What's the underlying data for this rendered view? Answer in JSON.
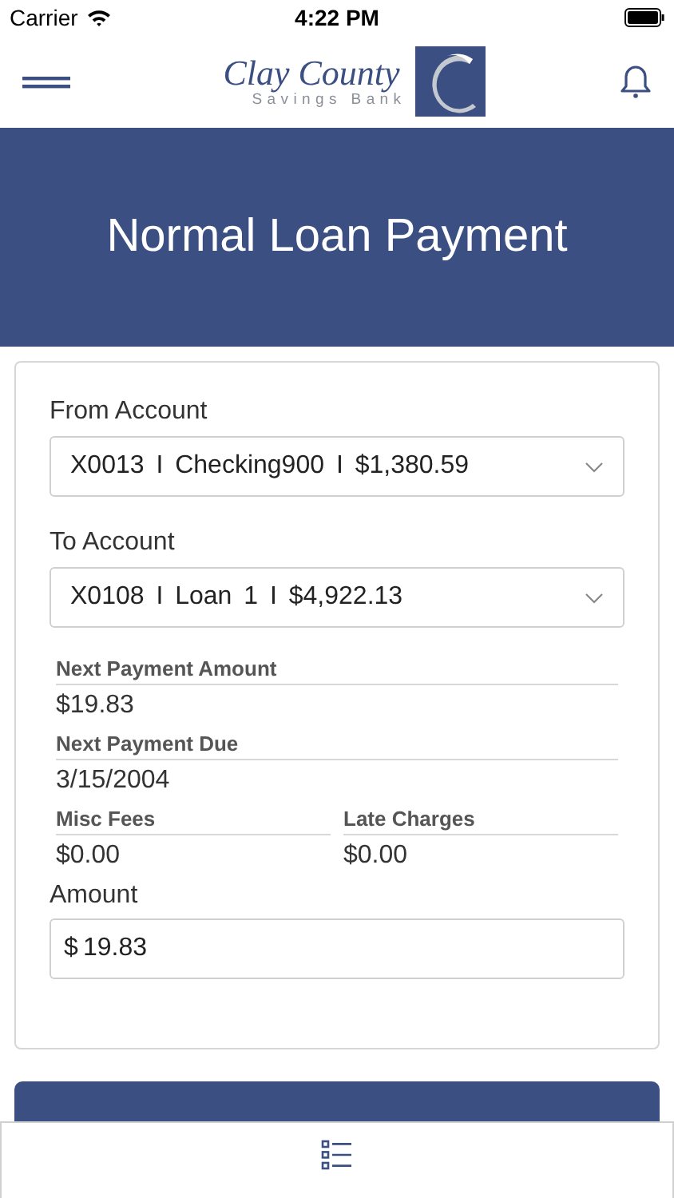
{
  "status_bar": {
    "carrier": "Carrier",
    "time": "4:22 PM"
  },
  "logo": {
    "name": "Clay County",
    "subtitle": "Savings Bank"
  },
  "title": "Normal Loan Payment",
  "accounts": [
    {
      "label": "From Account",
      "value": "X0013 I Checking900 I $1,380.59"
    },
    {
      "label": "To Account",
      "value": "X0108 I Loan 1 I $4,922.13"
    }
  ],
  "detail_rows": [
    [
      {
        "label": "Next Payment Amount",
        "value": "$19.83"
      }
    ],
    [
      {
        "label": "Next Payment Due",
        "value": "3/15/2004"
      }
    ],
    [
      {
        "label": "Misc Fees",
        "value": "$0.00"
      },
      {
        "label": "Late Charges",
        "value": "$0.00"
      }
    ]
  ],
  "amount": {
    "label": "Amount",
    "currency": "$",
    "value": "19.83"
  }
}
